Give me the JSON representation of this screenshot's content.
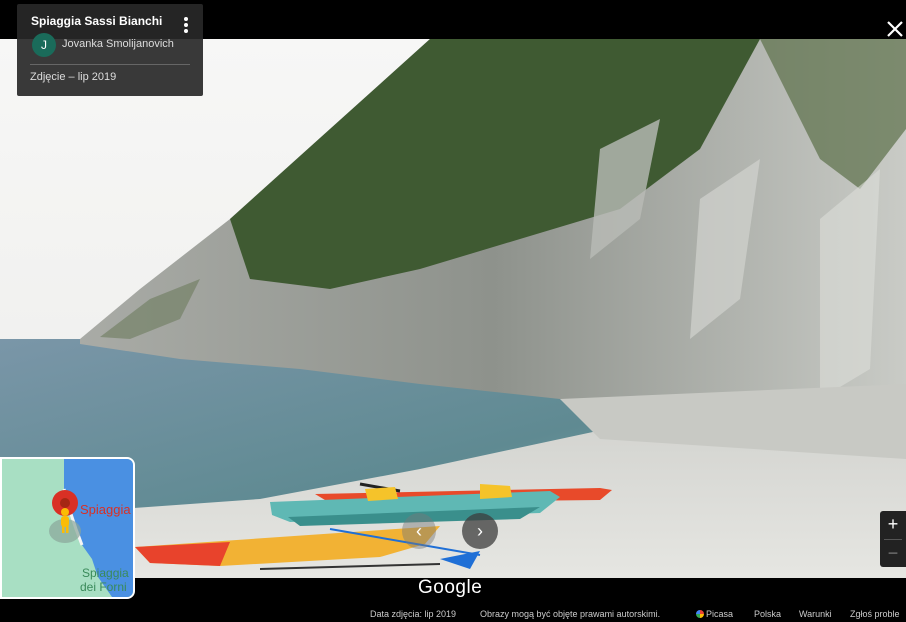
{
  "info": {
    "title": "Spiaggia Sassi Bianchi",
    "avatar_initial": "J",
    "author": "Jovanka Smolijanovich",
    "photo_date": "Zdjęcie – lip 2019"
  },
  "icons": {
    "menu": "more-vert-icon",
    "close": "close-icon",
    "prev": "chevron-left-icon",
    "next": "chevron-right-icon",
    "pin": "map-pin-icon",
    "pegman": "pegman-icon"
  },
  "nav": {
    "prev_glyph": "‹",
    "next_glyph": "›"
  },
  "zoom": {
    "in": "+",
    "out": "−"
  },
  "minimap": {
    "place_label": "Spiaggia",
    "nearby_label_line1": "Spiaggia",
    "nearby_label_line2": "dei Forni"
  },
  "branding": {
    "google": "Google"
  },
  "footer": {
    "date": "Data zdjęcia: lip 2019",
    "copyright": "Obrazy mogą być objęte prawami autorskimi.",
    "picasa": "Picasa",
    "country": "Polska",
    "terms": "Warunki",
    "report": "Zgłoś proble"
  },
  "colors": {
    "card_bg": "#282828",
    "avatar": "#1a6b5a",
    "pin": "#d93025",
    "map_water": "#4a90e2",
    "map_land": "#a8dfc3"
  }
}
